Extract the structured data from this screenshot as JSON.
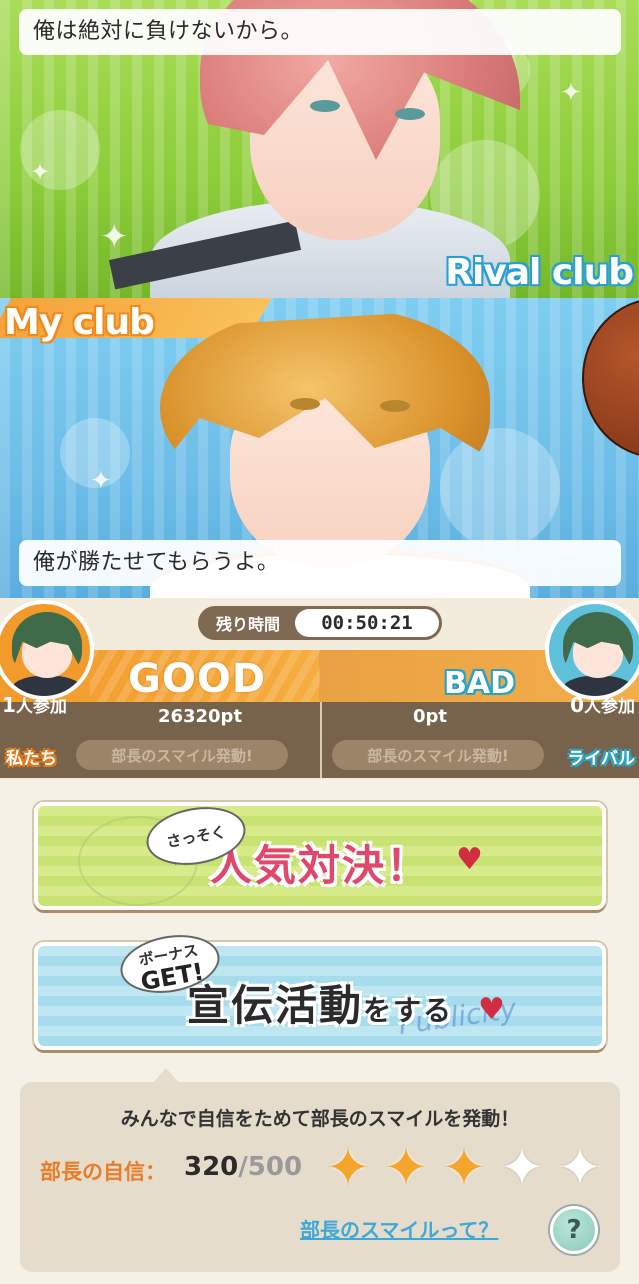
{
  "rival": {
    "speech": "俺は絶対に負けないから。",
    "club_label": "Rival club"
  },
  "mine": {
    "club_label": "My club",
    "speech": "俺が勝たせてもらうよ。"
  },
  "timer": {
    "label": "残り時間",
    "value": "00:50:21"
  },
  "score": {
    "my_status": "GOOD",
    "rival_status": "BAD",
    "my_points": "26320pt",
    "rival_points": "0pt",
    "my_smile": "部長のスマイル発動!",
    "rival_smile": "部長のスマイル発動!",
    "my_side": "私たち",
    "rival_side": "ライバル",
    "my_join_count": "1",
    "rival_join_count": "0",
    "join_suffix": "人参加"
  },
  "buttons": {
    "popular": {
      "badge": "さっそく",
      "label": "人気対決！"
    },
    "publicity": {
      "badge_top": "ボーナス",
      "badge_main": "GET!",
      "label_main": "宣伝活動",
      "label_suffix": "をする",
      "watermark": "Publicity"
    }
  },
  "info": {
    "title": "みんなで自信をためて部長のスマイルを発動！",
    "confidence_label": "部長の自信：",
    "confidence_current": "320",
    "confidence_max": "/500",
    "stars_filled": 3,
    "stars_total": 5,
    "help_link": "部長のスマイルって？",
    "help_icon": "?"
  },
  "colors": {
    "accent_orange": "#f39a2d",
    "accent_blue": "#5fc0dc",
    "pink_text": "#e0476a"
  }
}
